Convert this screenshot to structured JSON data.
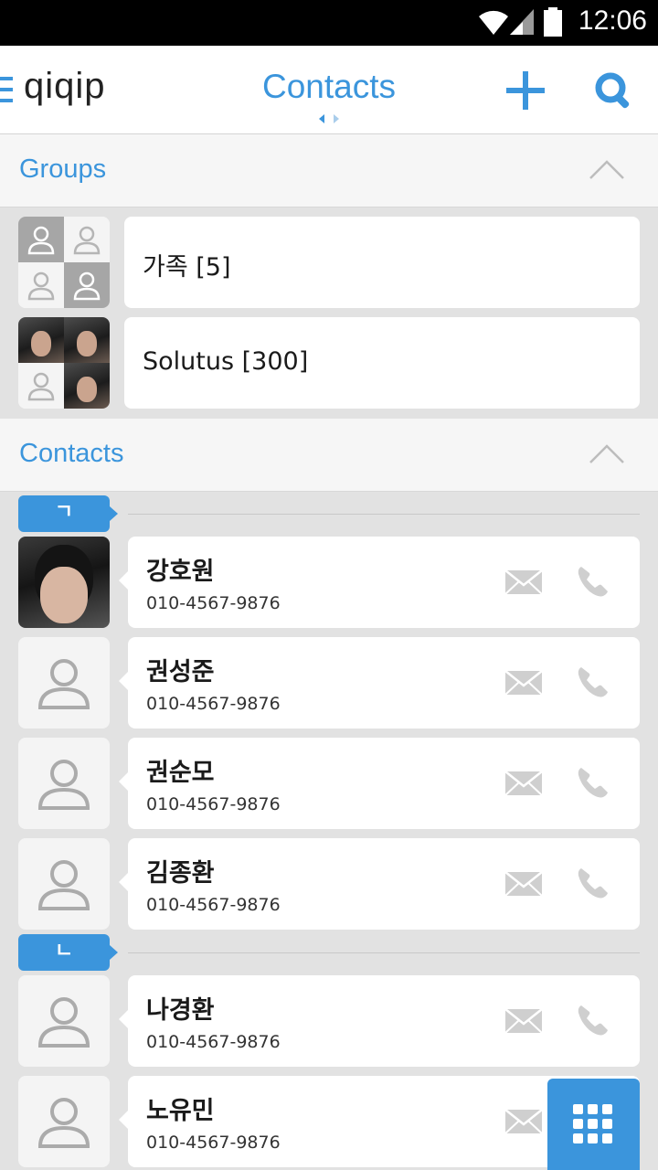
{
  "status_bar": {
    "time": "12:06"
  },
  "header": {
    "logo": "qiqip",
    "title": "Contacts"
  },
  "groups_section": {
    "title": "Groups",
    "items": [
      {
        "label": "가족 [5]"
      },
      {
        "label": "Solutus [300]"
      }
    ]
  },
  "contacts_section": {
    "title": "Contacts",
    "letters": [
      "ㄱ",
      "ㄴ"
    ],
    "items": [
      {
        "name": "강호원",
        "phone": "010-4567-9876"
      },
      {
        "name": "권성준",
        "phone": "010-4567-9876"
      },
      {
        "name": "권순모",
        "phone": "010-4567-9876"
      },
      {
        "name": "김종환",
        "phone": "010-4567-9876"
      },
      {
        "name": "나경환",
        "phone": "010-4567-9876"
      },
      {
        "name": "노유민",
        "phone": "010-4567-9876"
      }
    ]
  },
  "icons": {
    "menu": "hamburger-icon",
    "add": "plus-icon",
    "search": "search-icon",
    "collapse": "chevron-up-icon",
    "message": "envelope-icon",
    "call": "phone-icon",
    "dialpad": "dialpad-icon",
    "avatar": "person-icon"
  },
  "colors": {
    "accent": "#3b95dc",
    "background": "#e2e2e2",
    "card": "#ffffff"
  }
}
